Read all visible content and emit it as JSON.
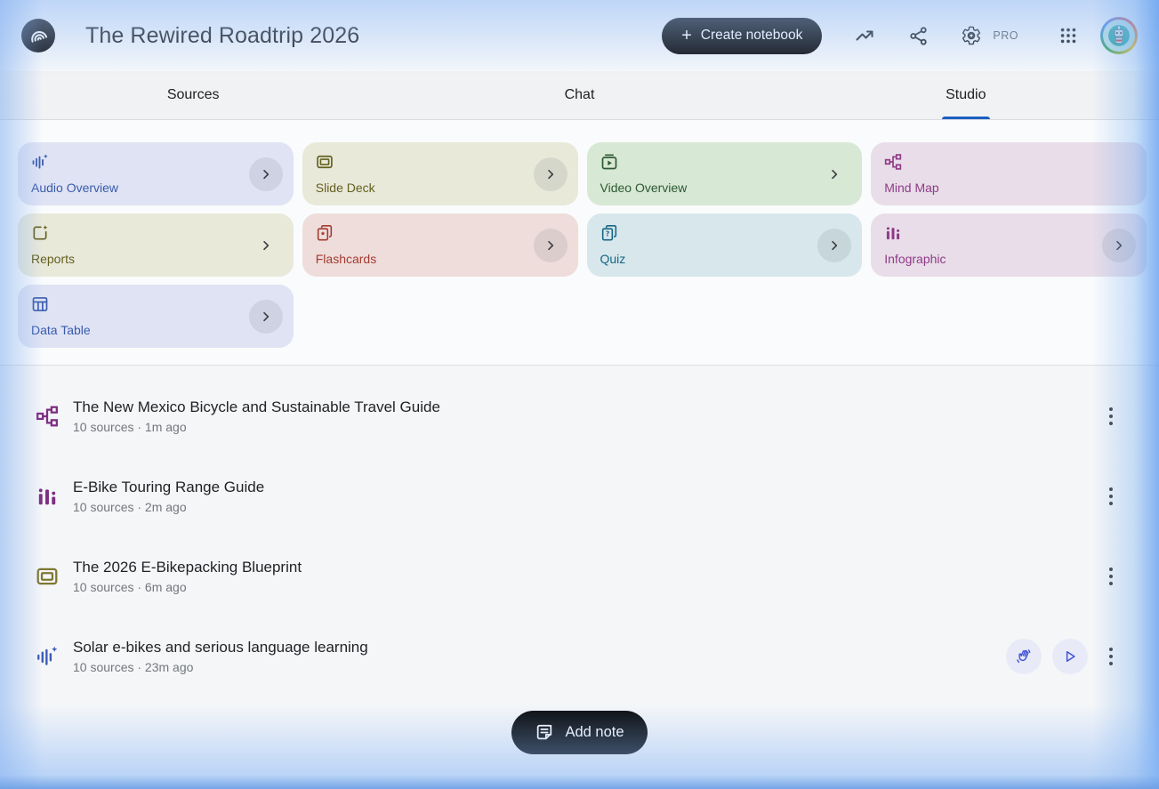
{
  "header": {
    "title": "The Rewired Roadtrip 2026",
    "create_notebook_label": "Create notebook",
    "plus_glyph": "+",
    "pro_badge": "PRO",
    "icons": [
      "notebooklm-logo",
      "trending-up-icon",
      "share-icon",
      "settings-gear-icon",
      "apps-grid-icon",
      "user-avatar-robot"
    ]
  },
  "tabs": [
    {
      "label": "Sources",
      "active": false
    },
    {
      "label": "Chat",
      "active": false
    },
    {
      "label": "Studio",
      "active": true
    }
  ],
  "colors": {
    "active_tab_underline": "#1b5fc4",
    "audio_card_bg": "#dfe3f4",
    "audio_card_fg": "#3a5bab",
    "slide_card_bg": "#e9e9da",
    "slide_card_fg": "#63601f",
    "video_card_bg": "#d7e8d5",
    "video_card_fg": "#2e5933",
    "mind_card_bg": "#e8dde8",
    "mind_card_fg": "#8f3b88",
    "flash_card_bg": "#eedddb",
    "flash_card_fg": "#a33b30",
    "quiz_card_bg": "#d7e7ec",
    "quiz_card_fg": "#176784",
    "pill_button_bg": "#0b0c0e",
    "action_circle_bg": "#e8ebf7",
    "action_icon_fg": "#3f51d6"
  },
  "studio": {
    "cards": [
      {
        "label": "Audio Overview",
        "icon": "audio-waveform-sparkle-icon",
        "chevron": "circle"
      },
      {
        "label": "Slide Deck",
        "icon": "slide-deck-icon",
        "chevron": "circle"
      },
      {
        "label": "Video Overview",
        "icon": "video-overview-icon",
        "chevron": "plain"
      },
      {
        "label": "Mind Map",
        "icon": "mind-map-icon",
        "chevron": "none"
      },
      {
        "label": "Reports",
        "icon": "reports-icon",
        "chevron": "plain"
      },
      {
        "label": "Flashcards",
        "icon": "flashcards-icon",
        "chevron": "circle"
      },
      {
        "label": "Quiz",
        "icon": "quiz-icon",
        "chevron": "circle"
      },
      {
        "label": "Infographic",
        "icon": "infographic-icon",
        "chevron": "circle"
      },
      {
        "label": "Data Table",
        "icon": "data-table-icon",
        "chevron": "circle"
      }
    ]
  },
  "artifacts": [
    {
      "title": "The New Mexico Bicycle and Sustainable Travel Guide",
      "meta": "10 sources · 1m ago",
      "icon": "mind-map-icon"
    },
    {
      "title": "E-Bike Touring Range Guide",
      "meta": "10 sources · 2m ago",
      "icon": "infographic-icon"
    },
    {
      "title": "The 2026 E-Bikepacking Blueprint",
      "meta": "10 sources · 6m ago",
      "icon": "slide-deck-icon"
    },
    {
      "title": "Solar e-bikes and serious language learning",
      "meta": "10 sources · 23m ago",
      "icon": "audio-waveform-sparkle-icon",
      "actions": [
        "interactive-mode",
        "play"
      ]
    }
  ],
  "footer": {
    "add_note_label": "Add note"
  }
}
